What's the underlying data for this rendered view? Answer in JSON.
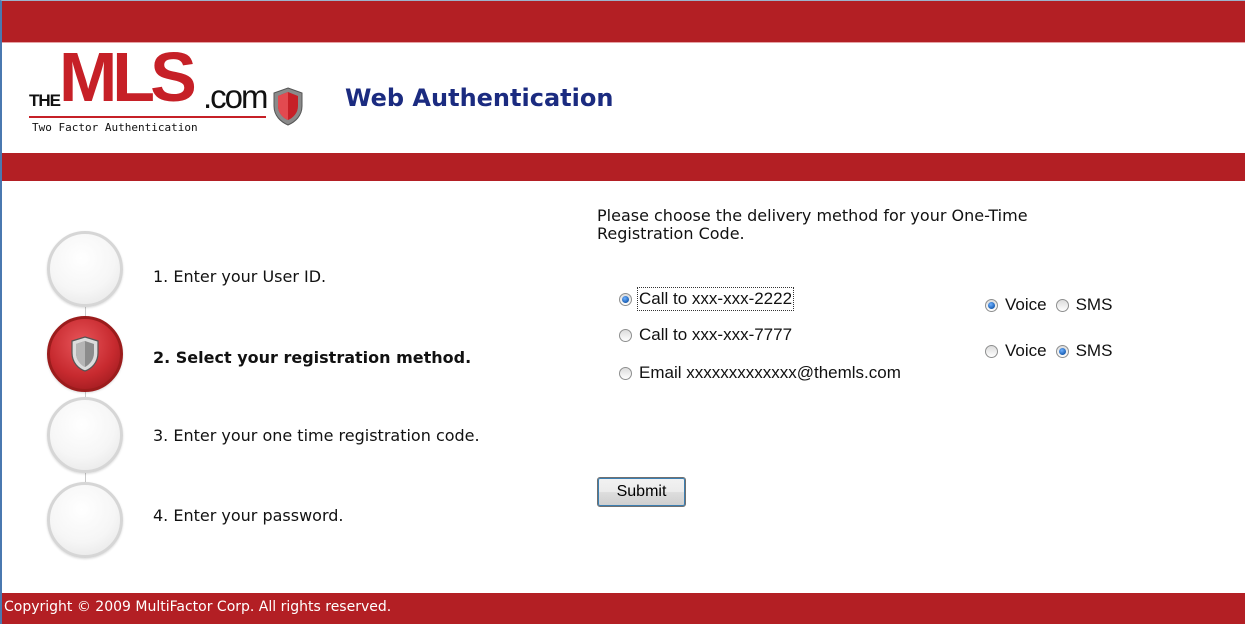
{
  "brand": {
    "logo_the": "THE",
    "logo_mls": "MLS",
    "logo_com": ".com",
    "logo_subtitle": "Two Factor Authentication",
    "logo_icon": "shield-icon"
  },
  "header": {
    "title": "Web Authentication"
  },
  "steps": [
    {
      "label": "1. Enter your User ID.",
      "active": false
    },
    {
      "label": "2. Select your registration method.",
      "active": true,
      "icon": "shield-icon"
    },
    {
      "label": "3. Enter your one time registration code.",
      "active": false
    },
    {
      "label": "4. Enter your password.",
      "active": false
    }
  ],
  "delivery": {
    "instruction": "Please choose the delivery method for your One-Time Registration Code.",
    "options": [
      {
        "label": "Call to xxx-xxx-2222",
        "selected": true
      },
      {
        "label": "Call to xxx-xxx-7777",
        "selected": false
      },
      {
        "label": "Email xxxxxxxxxxxxx@themls.com",
        "selected": false
      }
    ],
    "modes": [
      {
        "voice_label": "Voice",
        "sms_label": "SMS",
        "selected": "Voice"
      },
      {
        "voice_label": "Voice",
        "sms_label": "SMS",
        "selected": "SMS"
      }
    ],
    "submit_label": "Submit"
  },
  "footer": {
    "copyright": "Copyright © 2009 MultiFactor Corp. All rights reserved."
  },
  "colors": {
    "brand_red": "#b31f24",
    "title_blue": "#1b2b80",
    "radio_blue": "#1a5fb4"
  }
}
